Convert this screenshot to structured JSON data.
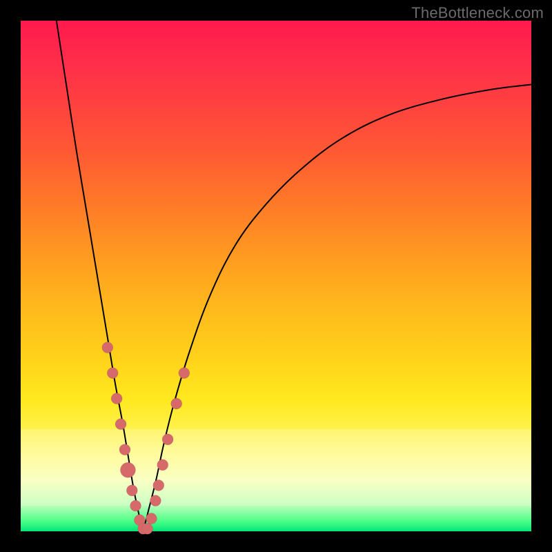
{
  "watermark": "TheBottleneck.com",
  "colors": {
    "frame": "#000000",
    "curve": "#000000",
    "bead": "#d66a6a",
    "gradient_top": "#ff1a4d",
    "gradient_bottom": "#00e676"
  },
  "chart_data": {
    "type": "line",
    "title": "",
    "xlabel": "",
    "ylabel": "",
    "xlim": [
      0,
      100
    ],
    "ylim": [
      0,
      100
    ],
    "grid": false,
    "legend": false,
    "series": [
      {
        "name": "left-branch",
        "x": [
          7,
          9,
          11,
          13,
          15,
          17,
          18.5,
          20,
          21,
          22,
          23,
          24
        ],
        "y": [
          100,
          87,
          74,
          62,
          50,
          38,
          29,
          21,
          15,
          9,
          4,
          0
        ]
      },
      {
        "name": "right-branch",
        "x": [
          24,
          25,
          26.5,
          28,
          30,
          33,
          37,
          42,
          48,
          55,
          63,
          72,
          82,
          92,
          100
        ],
        "y": [
          0,
          4,
          10,
          17,
          25,
          35,
          46,
          56,
          64,
          71,
          77,
          81.5,
          84.5,
          86.5,
          87.5
        ]
      }
    ],
    "markers": [
      {
        "x": 17.0,
        "y": 36,
        "r": 8
      },
      {
        "x": 18.0,
        "y": 31,
        "r": 8
      },
      {
        "x": 18.8,
        "y": 26,
        "r": 8
      },
      {
        "x": 19.6,
        "y": 21,
        "r": 8
      },
      {
        "x": 20.4,
        "y": 16,
        "r": 8
      },
      {
        "x": 21.0,
        "y": 12,
        "r": 11
      },
      {
        "x": 21.8,
        "y": 8,
        "r": 8
      },
      {
        "x": 22.5,
        "y": 5,
        "r": 8
      },
      {
        "x": 23.3,
        "y": 2.2,
        "r": 8
      },
      {
        "x": 24.0,
        "y": 0.5,
        "r": 8
      },
      {
        "x": 24.8,
        "y": 0.5,
        "r": 8
      },
      {
        "x": 25.6,
        "y": 2.5,
        "r": 8
      },
      {
        "x": 26.4,
        "y": 6,
        "r": 8
      },
      {
        "x": 27.0,
        "y": 9,
        "r": 8
      },
      {
        "x": 27.8,
        "y": 13,
        "r": 8
      },
      {
        "x": 28.8,
        "y": 18,
        "r": 8
      },
      {
        "x": 30.5,
        "y": 25,
        "r": 8
      },
      {
        "x": 32.0,
        "y": 31,
        "r": 8
      }
    ]
  }
}
